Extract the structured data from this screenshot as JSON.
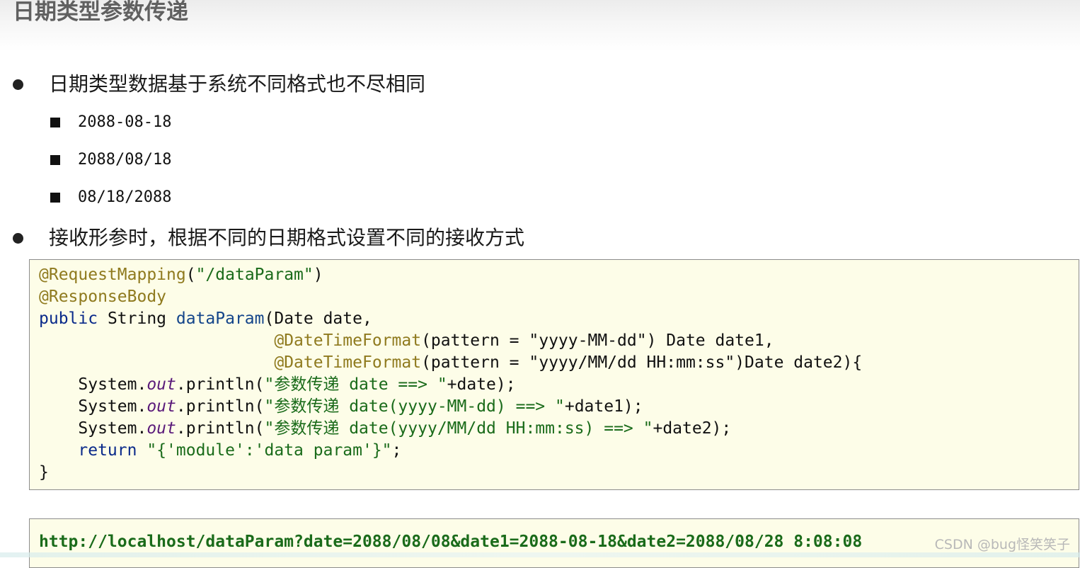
{
  "title": "日期类型参数传递",
  "bullets": [
    "日期类型数据基于系统不同格式也不尽相同",
    "接收形参时，根据不同的日期格式设置不同的接收方式"
  ],
  "date_formats": [
    "2088-08-18",
    "2088/08/18",
    "08/18/2088"
  ],
  "code": {
    "l1_ann": "@RequestMapping",
    "l1_p1": "(",
    "l1_str": "\"/dataParam\"",
    "l1_p2": ")",
    "l2_ann": "@ResponseBody",
    "l3_kw": "public",
    "l3_type": " String ",
    "l3_fn": "dataParam",
    "l3_rest": "(Date date,",
    "l4_indent": "                        ",
    "l4_ann": "@DateTimeFormat",
    "l4_p1": "(pattern = ",
    "l4_str": "\"yyyy-MM-dd\"",
    "l4_rest": ") Date date1,",
    "l5_indent": "                        ",
    "l5_ann": "@DateTimeFormat",
    "l5_p1": "(pattern = ",
    "l5_str": "\"yyyy/MM/dd HH:mm:ss\"",
    "l5_rest": ")Date date2){",
    "l6_pre": "    System.",
    "l6_fld": "out",
    "l6_mid": ".println(",
    "l6_str": "\"参数传递 date ==> \"",
    "l6_rest": "+date);",
    "l7_pre": "    System.",
    "l7_fld": "out",
    "l7_mid": ".println(",
    "l7_str": "\"参数传递 date(yyyy-MM-dd) ==> \"",
    "l7_rest": "+date1);",
    "l8_pre": "    System.",
    "l8_fld": "out",
    "l8_mid": ".println(",
    "l8_str": "\"参数传递 date(yyyy/MM/dd HH:mm:ss) ==> \"",
    "l8_rest": "+date2);",
    "l9_indent": "    ",
    "l9_kw": "return",
    "l9_sp": " ",
    "l9_str": "\"{'module':'data param'}\"",
    "l9_rest": ";",
    "l10": "}"
  },
  "url": "http://localhost/dataParam?date=2088/08/08&date1=2088-08-18&date2=2088/08/28 8:08:08",
  "watermark": "CSDN @bug怪笑笑子",
  "colors": {
    "annotation": "#8f7a1e",
    "string": "#1a6b1a",
    "keyword": "#0a2a8a",
    "code_bg": "#fdfde8"
  }
}
